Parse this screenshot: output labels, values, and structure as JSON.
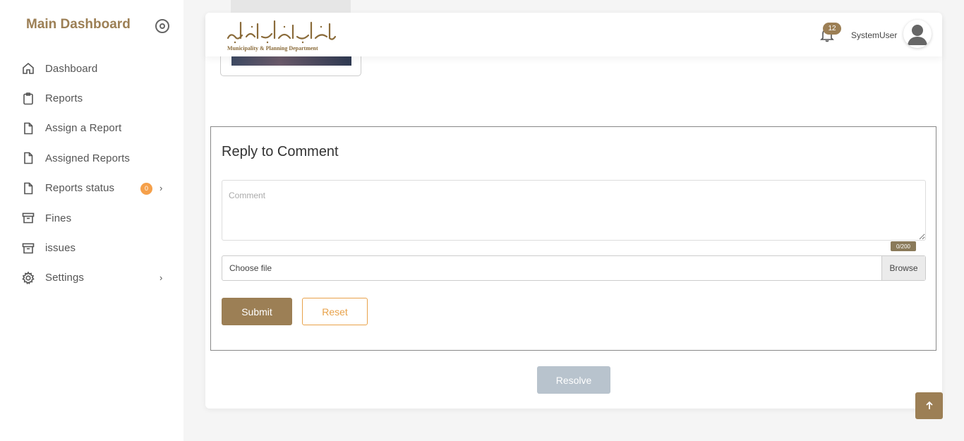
{
  "sidebar": {
    "brand": "Main Dashboard",
    "items": [
      {
        "label": "Dashboard",
        "icon": "home-icon"
      },
      {
        "label": "Reports",
        "icon": "clipboard-icon"
      },
      {
        "label": "Assign a Report",
        "icon": "file-icon"
      },
      {
        "label": "Assigned Reports",
        "icon": "file-icon"
      },
      {
        "label": "Reports status",
        "icon": "file-icon",
        "badge": "0",
        "has_submenu": true
      },
      {
        "label": "Fines",
        "icon": "archive-icon"
      },
      {
        "label": "issues",
        "icon": "archive-icon"
      },
      {
        "label": "Settings",
        "icon": "gear-icon",
        "has_submenu": true
      }
    ]
  },
  "header": {
    "logo_english": "Municipality & Planning Department",
    "notifications_count": "12",
    "username": "SystemUser"
  },
  "reply": {
    "title": "Reply to Comment",
    "comment_placeholder": "Comment",
    "comment_value": "",
    "counter": "0/200",
    "file_label": "Choose file",
    "browse_label": "Browse",
    "submit_label": "Submit",
    "reset_label": "Reset"
  },
  "resolve_label": "Resolve",
  "colors": {
    "accent": "#9c7f55",
    "reset_text": "#e8a24a",
    "badge_orange": "#f5a04a",
    "resolve_disabled": "#b8c3cd"
  }
}
